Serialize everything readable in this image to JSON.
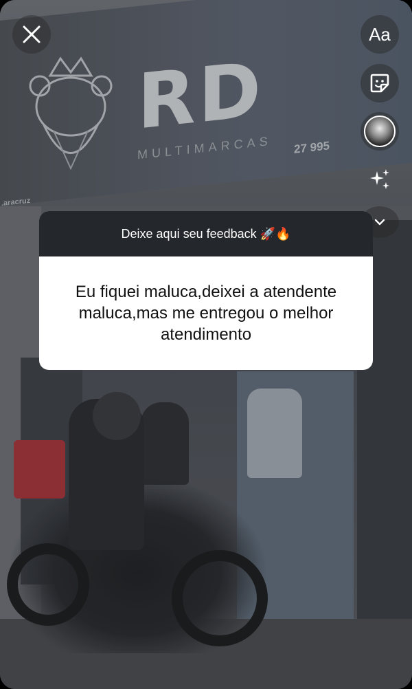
{
  "story": {
    "background": {
      "store_name": "RD",
      "store_subtitle": "MULTIMARCAS",
      "phone_partial": "27 995",
      "handle_partial": ".aracruz"
    },
    "controls": {
      "close_icon": "close-icon",
      "text_tool_label": "Aa",
      "sticker_icon": "sticker-icon",
      "avatar_icon": "profile-avatar",
      "effects_icon": "sparkles-icon",
      "more_icon": "chevron-down-icon"
    },
    "question_card": {
      "prompt": "Deixe aqui seu feedback 🚀🔥",
      "answer": "Eu fiquei maluca,deixei a atendente maluca,mas me entregou o melhor atendimento"
    }
  },
  "colors": {
    "card_header": "#24272b",
    "card_body": "#ffffff",
    "overlay_button": "rgba(40,40,40,0.45)"
  }
}
